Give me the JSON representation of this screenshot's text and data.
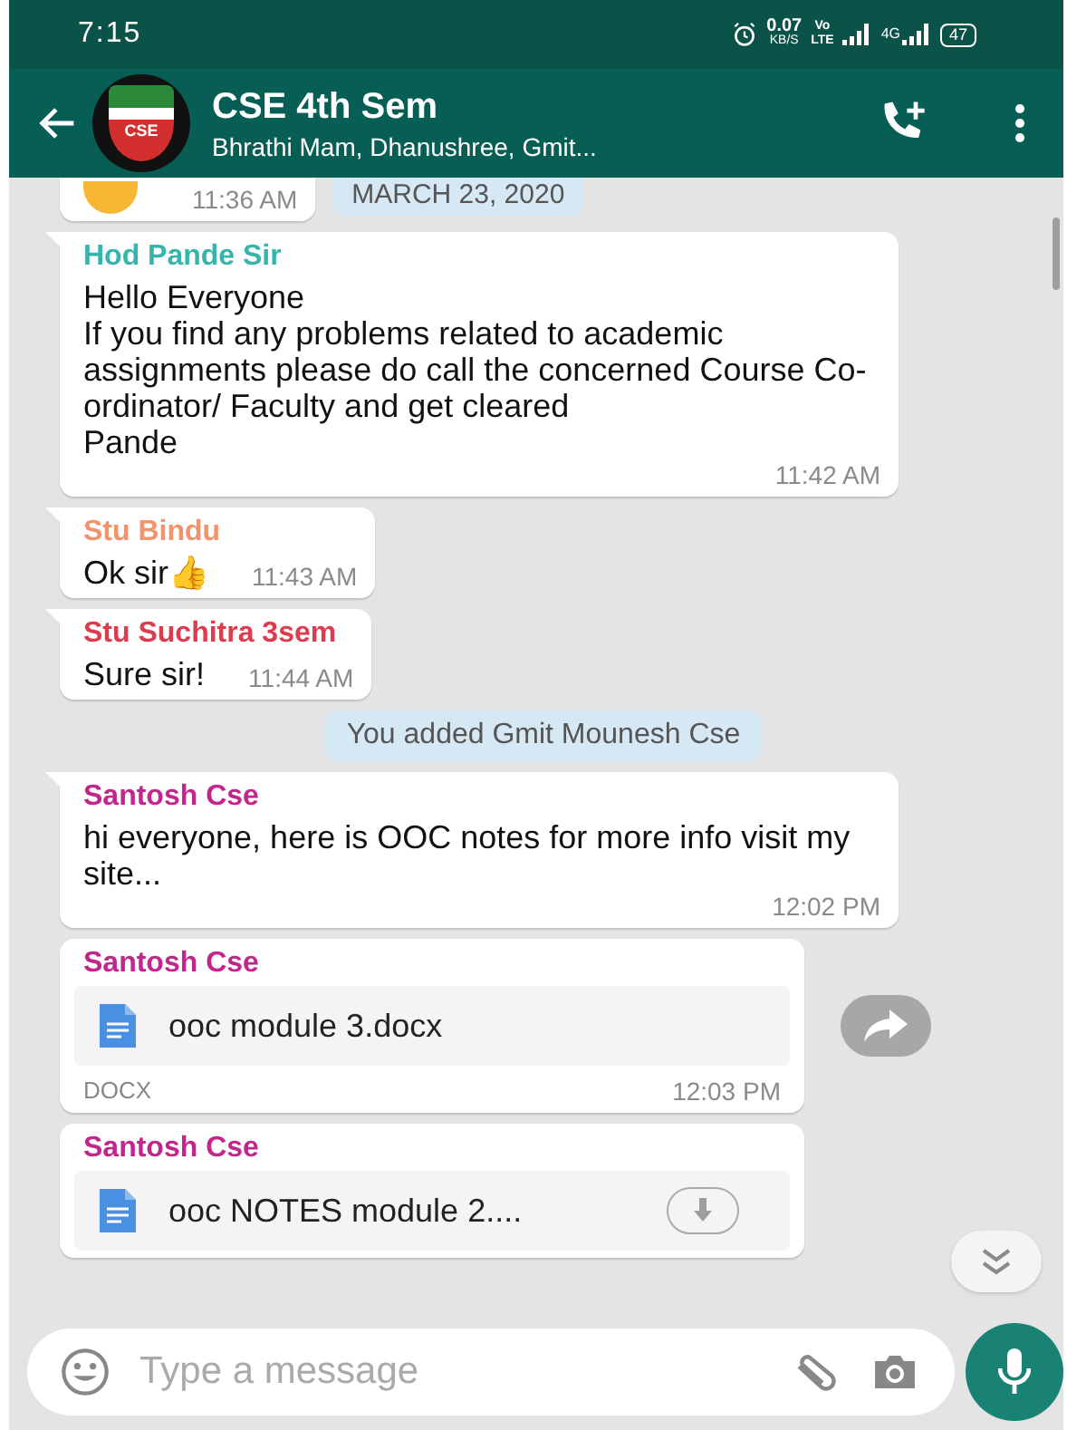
{
  "status_bar": {
    "time": "7:15",
    "speed": "0.07",
    "speed_unit": "KB/S",
    "volte_top": "Vo",
    "volte_bottom": "LTE",
    "network": "4G",
    "battery": "47"
  },
  "header": {
    "title": "CSE 4th Sem",
    "subtitle": "Bhrathi Mam, Dhanushree, Gmit...",
    "logo_text": "CSE"
  },
  "date_pill": "MARCH 23, 2020",
  "messages": [
    {
      "kind": "partial",
      "time": "11:36 AM"
    },
    {
      "kind": "text",
      "sender": "Hod Pande Sir",
      "color": "#35b5ac",
      "text": "Hello Everyone\nIf you find any problems related to academic assignments please do call the concerned Course Co-ordinator/ Faculty and get cleared\nPande",
      "time": "11:42 AM"
    },
    {
      "kind": "text",
      "sender": "Stu Bindu",
      "color": "#f2936b",
      "text": "Ok sir👍",
      "time": "11:43 AM"
    },
    {
      "kind": "text",
      "sender": "Stu Suchitra 3sem",
      "color": "#dd3b4e",
      "text": "Sure sir!",
      "time": "11:44 AM"
    },
    {
      "kind": "system",
      "text": "You added Gmit Mounesh Cse"
    },
    {
      "kind": "text",
      "sender": "Santosh Cse",
      "color": "#c2268c",
      "text": "hi everyone, here is OOC notes for more info visit my site...",
      "time": "12:02 PM"
    },
    {
      "kind": "document",
      "sender": "Santosh Cse",
      "color": "#c2268c",
      "file": "ooc module 3.docx",
      "type": "DOCX",
      "time": "12:03 PM",
      "downloaded": true
    },
    {
      "kind": "document",
      "sender": "Santosh Cse",
      "color": "#c2268c",
      "file": "ooc NOTES module 2....",
      "downloaded": false
    }
  ],
  "composer": {
    "placeholder": "Type a message"
  }
}
